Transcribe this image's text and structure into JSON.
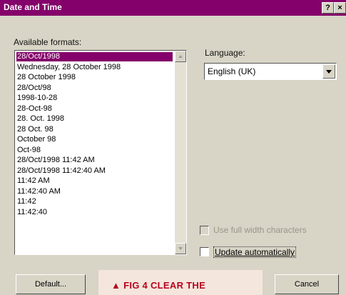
{
  "window": {
    "title": "Date and Time",
    "help_label": "?",
    "close_label": "×"
  },
  "formats": {
    "label": "Available formats:",
    "items": [
      "28/Oct/1998",
      "Wednesday, 28 October 1998",
      "28 October 1998",
      "28/Oct/98",
      "1998-10-28",
      "28-Oct-98",
      "28. Oct. 1998",
      "28 Oct. 98",
      "October 98",
      "Oct-98",
      "28/Oct/1998 11:42 AM",
      "28/Oct/1998 11:42:40 AM",
      "11:42 AM",
      "11:42:40 AM",
      "11:42",
      "11:42:40"
    ],
    "selected_index": 0
  },
  "language": {
    "label": "Language:",
    "value": "English (UK)"
  },
  "options": {
    "full_width_label": "Use full width characters",
    "full_width_enabled": false,
    "update_label": "Update automatically",
    "update_checked": false
  },
  "buttons": {
    "default_label": "Default...",
    "cancel_label": "Cancel"
  },
  "caption": {
    "text": "▲ FIG 4 CLEAR THE"
  }
}
